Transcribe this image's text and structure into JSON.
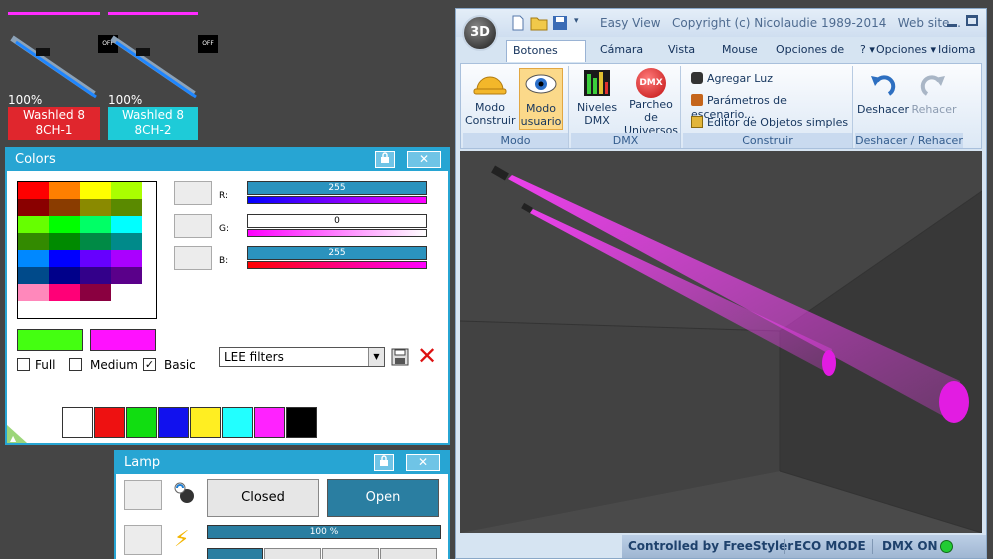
{
  "fixtures": [
    {
      "percent": "100%",
      "name": "Washled 8",
      "sub": "8CH-1",
      "color": "#e0262d",
      "off": "OFF"
    },
    {
      "percent": "100%",
      "name": "Washled 8",
      "sub": "8CH-2",
      "color": "#1ecbd8",
      "off": "OFF"
    }
  ],
  "colors_panel": {
    "title": "Colors",
    "r_label": "R:",
    "g_label": "G:",
    "b_label": "B:",
    "r_value": "255",
    "g_value": "0",
    "b_value": "255",
    "filter_select": "LEE filters",
    "chk_full": "Full",
    "chk_medium": "Medium",
    "chk_basic": "Basic",
    "checkmark": "✓",
    "close_glyph": "✕",
    "delete_glyph": "✕",
    "primary_color": "#44ff11",
    "secondary_color": "#ff11ff",
    "palette": [
      "#ffffff",
      "#ee1111",
      "#11dd11",
      "#1111ee",
      "#ffee22",
      "#22ffff",
      "#ff22ff",
      "#000000"
    ]
  },
  "lamp_panel": {
    "title": "Lamp",
    "closed_label": "Closed",
    "open_label": "Open",
    "progress": "100 %",
    "close_glyph": "✕"
  },
  "app": {
    "title": "Easy View   Copyright (c) Nicolaudie 1989-2014   Web site...",
    "logo": "3D",
    "tabs": [
      "Botones están",
      "Cámara",
      "Vista",
      "Mouse",
      "Opciones de r"
    ],
    "right_menu": [
      "?",
      "Opciones",
      "Idioma"
    ],
    "groups": {
      "modo": {
        "title": "Modo",
        "btn1": [
          "Modo",
          "Construir"
        ],
        "btn2": [
          "Modo",
          "usuario"
        ]
      },
      "dmx": {
        "title": "DMX",
        "btn1": [
          "Niveles",
          "DMX"
        ],
        "btn2": [
          "Parcheo de",
          "Universos"
        ],
        "dmx_badge": "DMX"
      },
      "construir": {
        "title": "Construir",
        "items": [
          "Agregar Luz",
          "Parámetros de escenario...",
          "Editor de Objetos simples"
        ]
      },
      "undo": {
        "title": "Deshacer / Rehacer",
        "undo": "Deshacer",
        "redo": "Rehacer"
      }
    },
    "status": {
      "controlled": "Controlled by FreeStyler",
      "eco": "ECO MODE",
      "dmx": "DMX ON"
    },
    "status_led": "#22cc33"
  }
}
